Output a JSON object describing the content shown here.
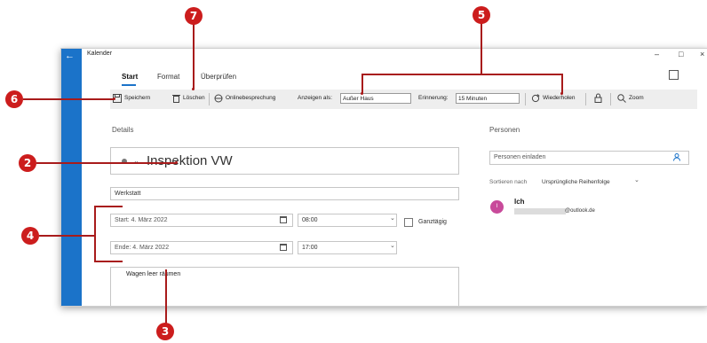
{
  "window": {
    "title": "Kalender",
    "back_glyph": "←",
    "minimize_glyph": "–",
    "maximize_glyph": "□",
    "close_glyph": "×"
  },
  "tabs": [
    {
      "label": "Start"
    },
    {
      "label": "Format"
    },
    {
      "label": "Überprüfen"
    }
  ],
  "toolbar": {
    "save_label": "Speichern",
    "delete_label": "Löschen",
    "online_meeting_label": "Onlinebesprechung",
    "show_as_label": "Anzeigen als:",
    "show_as_value": "Außer Haus",
    "reminder_label": "Erinnerung:",
    "reminder_value": "15 Minuten",
    "repeat_label": "Wiederholen",
    "zoom_label": "Zoom"
  },
  "details": {
    "heading": "Details",
    "subject": "Inspektion VW",
    "location": "Werkstatt",
    "start_date": "Start: 4. März 2022",
    "start_time": "08:00",
    "allday_label": "Ganztägig",
    "end_date": "Ende: 4. März 2022",
    "end_time": "17:00",
    "body_text": "Wagen leer räumen"
  },
  "people": {
    "heading": "Personen",
    "invite_placeholder": "Personen einladen",
    "sort_label": "Sortieren nach",
    "sort_value": "Ursprüngliche Reihenfolge",
    "attendee_initial": "I",
    "attendee_name": "Ich",
    "attendee_email": "@outlook.de"
  },
  "callouts": {
    "c2": "2",
    "c3": "3",
    "c4": "4",
    "c5": "5",
    "c6": "6",
    "c7": "7"
  },
  "colors": {
    "accent": "#1b73c9",
    "callout": "#cc1d1d",
    "avatar": "#c84a9a",
    "toolbar_bg": "#eeeeee"
  }
}
